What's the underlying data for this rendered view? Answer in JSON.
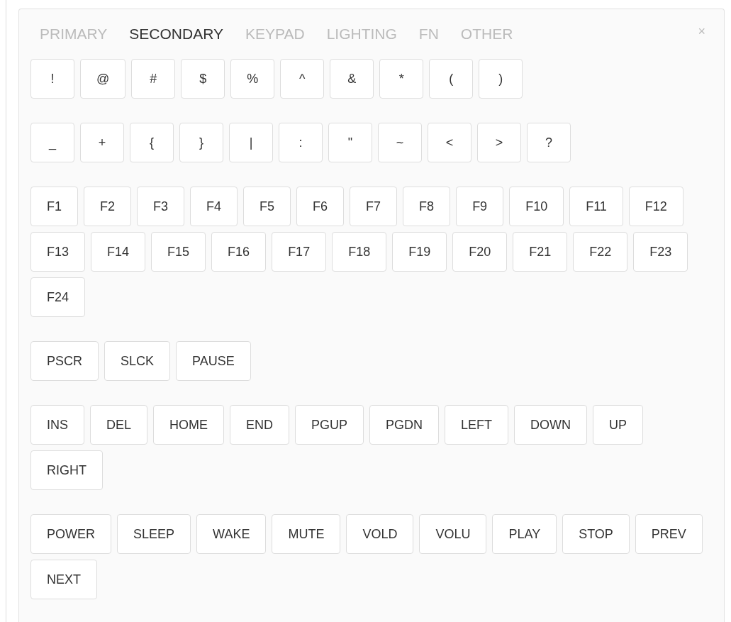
{
  "tabs": [
    {
      "label": "PRIMARY",
      "selected": false
    },
    {
      "label": "SECONDARY",
      "selected": true
    },
    {
      "label": "KEYPAD",
      "selected": false
    },
    {
      "label": "LIGHTING",
      "selected": false
    },
    {
      "label": "FN",
      "selected": false
    },
    {
      "label": "OTHER",
      "selected": false
    }
  ],
  "close": "×",
  "key_groups": [
    {
      "keys": [
        "!",
        "@",
        "#",
        "$",
        "%",
        "^",
        "&",
        "*",
        "(",
        ")"
      ]
    },
    {
      "keys": [
        "_",
        "+",
        "{",
        "}",
        "|",
        ":",
        "\"",
        "~",
        "<",
        ">",
        "?"
      ]
    },
    {
      "keys": [
        "F1",
        "F2",
        "F3",
        "F4",
        "F5",
        "F6",
        "F7",
        "F8",
        "F9",
        "F10",
        "F11",
        "F12",
        "F13",
        "F14",
        "F15",
        "F16",
        "F17",
        "F18",
        "F19",
        "F20",
        "F21",
        "F22",
        "F23",
        "F24"
      ]
    },
    {
      "keys": [
        "PSCR",
        "SLCK",
        "PAUSE"
      ]
    },
    {
      "keys": [
        "INS",
        "DEL",
        "HOME",
        "END",
        "PGUP",
        "PGDN",
        "LEFT",
        "DOWN",
        "UP",
        "RIGHT"
      ]
    },
    {
      "keys": [
        "POWER",
        "SLEEP",
        "WAKE",
        "MUTE",
        "VOLD",
        "VOLU",
        "PLAY",
        "STOP",
        "PREV",
        "NEXT"
      ]
    }
  ]
}
